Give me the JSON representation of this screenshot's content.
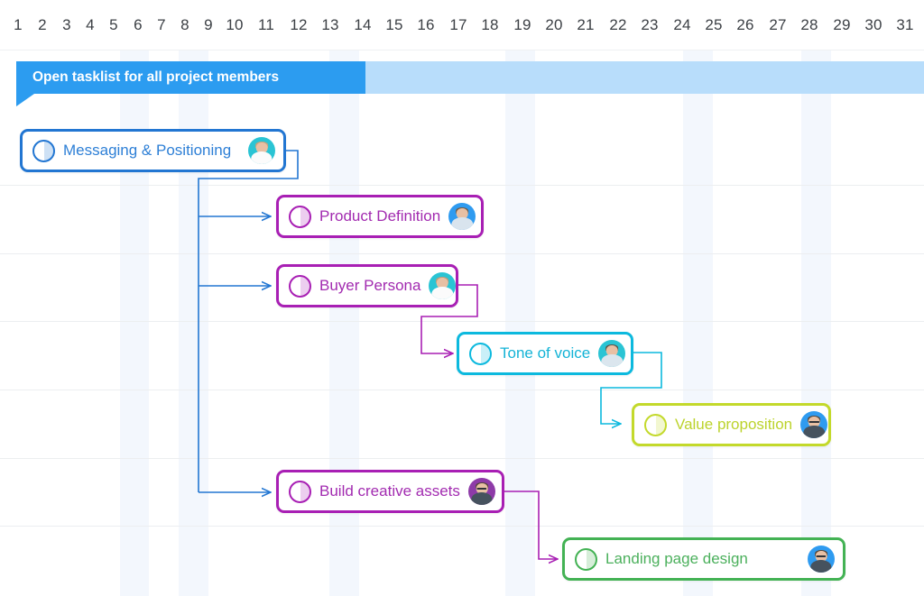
{
  "header": {
    "dates": [
      "1",
      "2",
      "3",
      "4",
      "5",
      "6",
      "7",
      "8",
      "9",
      "10",
      "11",
      "12",
      "13",
      "14",
      "15",
      "16",
      "17",
      "18",
      "19",
      "20",
      "21",
      "22",
      "23",
      "24",
      "25",
      "26",
      "27",
      "28",
      "29",
      "30",
      "31"
    ]
  },
  "banner": {
    "text": "Open tasklist for all project members",
    "color": "#2c9cf0",
    "track_color": "#b8ddfb"
  },
  "tasks": [
    {
      "id": "messaging-positioning",
      "label": "Messaging & Positioning",
      "color": "#2276d2",
      "progress_icon": "half-circle-progress-icon",
      "assignee_avatar": "avatar-woman-teal"
    },
    {
      "id": "product-definition",
      "label": "Product Definition",
      "color": "#a81fb4",
      "progress_icon": "half-circle-progress-icon",
      "assignee_avatar": "avatar-man-blue"
    },
    {
      "id": "buyer-persona",
      "label": "Buyer Persona",
      "color": "#a81fb4",
      "progress_icon": "half-circle-progress-icon",
      "assignee_avatar": "avatar-woman-teal"
    },
    {
      "id": "tone-of-voice",
      "label": "Tone of voice",
      "color": "#0cb9de",
      "progress_icon": "half-circle-progress-icon",
      "assignee_avatar": "avatar-man-teal"
    },
    {
      "id": "value-proposition",
      "label": "Value proposition",
      "color": "#c3d92b",
      "progress_icon": "half-circle-progress-icon",
      "assignee_avatar": "avatar-man-glasses-blue"
    },
    {
      "id": "build-creative-assets",
      "label": "Build creative assets",
      "color": "#a81fb4",
      "progress_icon": "half-circle-progress-icon",
      "assignee_avatar": "avatar-man-glasses-purple"
    },
    {
      "id": "landing-page-design",
      "label": "Landing  page design",
      "color": "#43b254",
      "progress_icon": "half-circle-progress-icon",
      "assignee_avatar": "avatar-man-glasses-blue"
    }
  ],
  "dependencies": [
    {
      "from": "messaging-positioning",
      "to": "product-definition",
      "color": "#2276d2"
    },
    {
      "from": "messaging-positioning",
      "to": "buyer-persona",
      "color": "#2276d2"
    },
    {
      "from": "messaging-positioning",
      "to": "build-creative-assets",
      "color": "#2276d2"
    },
    {
      "from": "buyer-persona",
      "to": "tone-of-voice",
      "color": "#a81fb4"
    },
    {
      "from": "tone-of-voice",
      "to": "value-proposition",
      "color": "#0cb9de"
    },
    {
      "from": "build-creative-assets",
      "to": "landing-page-design",
      "color": "#a81fb4"
    }
  ]
}
